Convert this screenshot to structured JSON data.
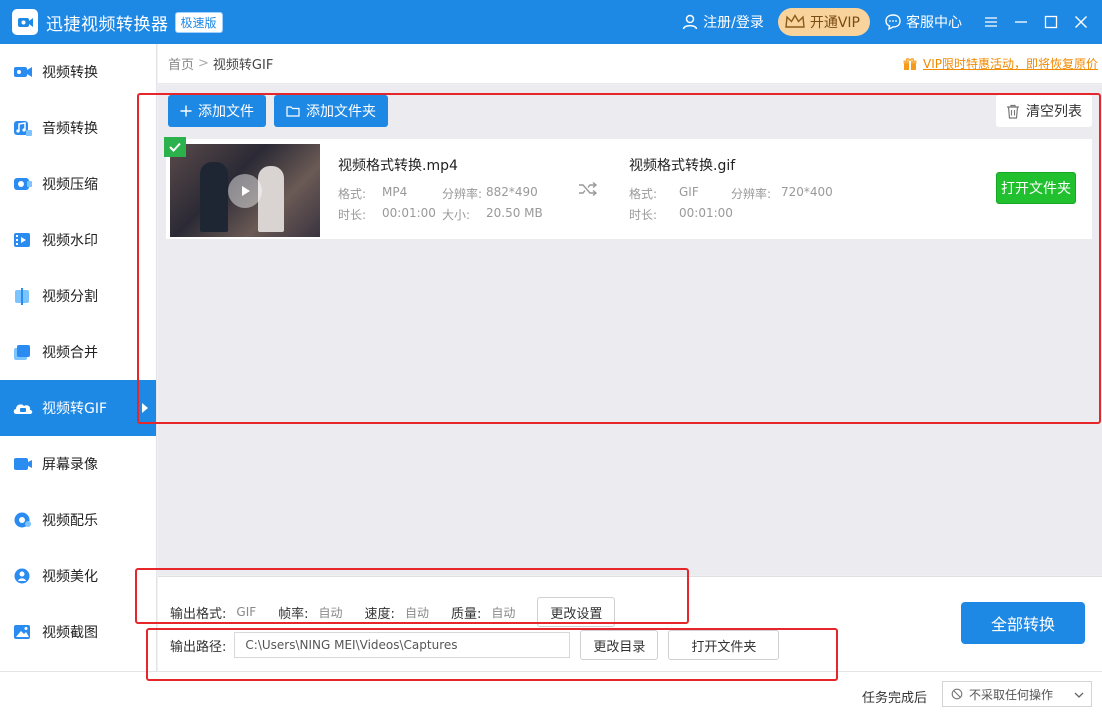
{
  "titlebar": {
    "app_title": "迅捷视频转换器",
    "edition": "极速版",
    "login": "注册/登录",
    "vip": "开通VIP",
    "service": "客服中心",
    "brand_color": "#1e88e5"
  },
  "sidebar": {
    "items": [
      {
        "label": "视频转换",
        "icon": "video-convert-icon"
      },
      {
        "label": "音频转换",
        "icon": "audio-convert-icon"
      },
      {
        "label": "视频压缩",
        "icon": "video-compress-icon"
      },
      {
        "label": "视频水印",
        "icon": "video-watermark-icon"
      },
      {
        "label": "视频分割",
        "icon": "video-split-icon"
      },
      {
        "label": "视频合并",
        "icon": "video-merge-icon"
      },
      {
        "label": "视频转GIF",
        "icon": "video-to-gif-icon",
        "active": true
      },
      {
        "label": "屏幕录像",
        "icon": "screen-record-icon"
      },
      {
        "label": "视频配乐",
        "icon": "video-music-icon"
      },
      {
        "label": "视频美化",
        "icon": "video-beautify-icon"
      },
      {
        "label": "视频截图",
        "icon": "video-screenshot-icon"
      }
    ]
  },
  "breadcrumb": {
    "home": "首页",
    "separator": ">",
    "current": "视频转GIF"
  },
  "promo": "VIP限时特惠活动，即将恢复原价",
  "toolbar": {
    "add_file": "添加文件",
    "add_folder": "添加文件夹",
    "clear_list": "清空列表"
  },
  "file": {
    "source_name": "视频格式转换.mp4",
    "format_label": "格式:",
    "source_format": "MP4",
    "resolution_label": "分辨率:",
    "source_resolution": "882*490",
    "duration_label": "时长:",
    "source_duration": "00:01:00",
    "size_label": "大小:",
    "source_size": "20.50 MB",
    "target_name": "视频格式转换.gif",
    "target_format": "GIF",
    "target_resolution": "720*400",
    "target_duration": "00:01:00",
    "open_folder": "打开文件夹"
  },
  "settings": {
    "output_format_label": "输出格式:",
    "output_format": "GIF",
    "frame_rate_label": "帧率:",
    "frame_rate": "自动",
    "speed_label": "速度:",
    "speed": "自动",
    "quality_label": "质量:",
    "quality": "自动",
    "change_settings": "更改设置"
  },
  "output": {
    "path_label": "输出路径:",
    "path": "C:\\Users\\NING MEI\\Videos\\Captures",
    "change_dir": "更改目录",
    "open_folder": "打开文件夹"
  },
  "convert_all": "全部转换",
  "footer": {
    "task_label": "任务完成后",
    "task_option": "不采取任何操作"
  }
}
